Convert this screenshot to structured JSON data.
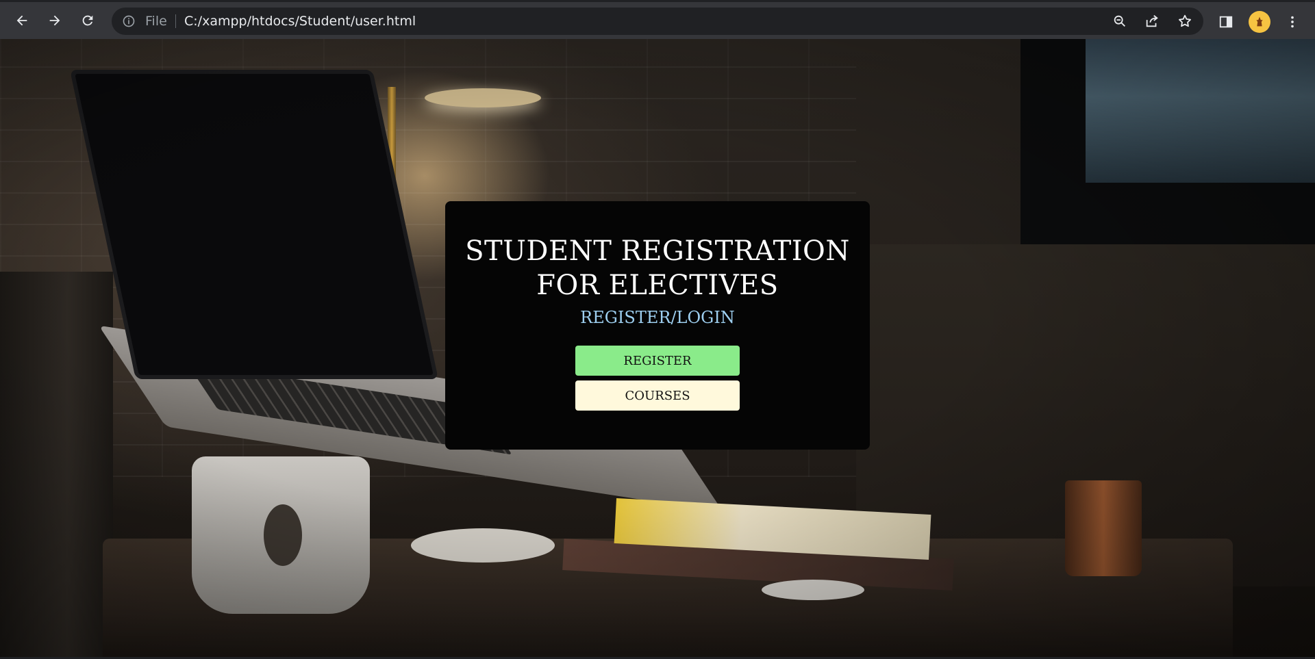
{
  "browser": {
    "file_label": "File",
    "url": "C:/xampp/htdocs/Student/user.html",
    "icons": {
      "back": "arrow-left-icon",
      "forward": "arrow-right-icon",
      "reload": "reload-icon",
      "site_info": "info-icon",
      "zoom": "zoom-icon",
      "share": "share-icon",
      "bookmark": "star-icon",
      "side_panel": "side-panel-icon",
      "profile": "avatar",
      "menu": "kebab-menu-icon"
    }
  },
  "page": {
    "title": "STUDENT REGISTRATION FOR ELECTIVES",
    "subtitle": "REGISTER/LOGIN",
    "buttons": {
      "register": "REGISTER",
      "courses": "COURSES"
    }
  },
  "colors": {
    "card_bg": "#050505",
    "title": "#ffffff",
    "subtitle": "#9ecff0",
    "register_button": "#8aeb8a",
    "courses_button": "#fff9dc"
  }
}
